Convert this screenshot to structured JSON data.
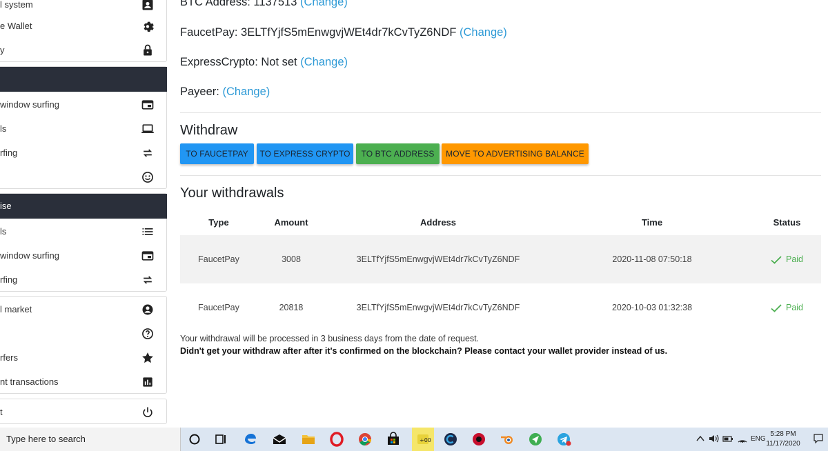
{
  "sidebar": {
    "group1": [
      {
        "label": "l system",
        "icon": "account-box-icon"
      },
      {
        "label": "e Wallet",
        "icon": "gear-icon"
      },
      {
        "label": "y",
        "icon": "lock-icon"
      }
    ],
    "group2": [
      {
        "label": "window surfing",
        "icon": "browser-window-icon"
      },
      {
        "label": "ls",
        "icon": "laptop-icon"
      },
      {
        "label": "rfing",
        "icon": "repeat-arrows-icon"
      },
      {
        "label": "",
        "icon": "smiley-icon"
      }
    ],
    "group3_header": "ise",
    "group3": [
      {
        "label": "ls",
        "icon": "list-icon"
      },
      {
        "label": "window surfing",
        "icon": "browser-window-icon"
      },
      {
        "label": "rfing",
        "icon": "repeat-arrows-icon"
      }
    ],
    "group4": [
      {
        "label": "l market",
        "icon": "account-circle-icon"
      },
      {
        "label": "",
        "icon": "help-circle-icon"
      },
      {
        "label": "rfers",
        "icon": "star-icon"
      },
      {
        "label": "nt transactions",
        "icon": "bar-chart-icon"
      }
    ],
    "group5": [
      {
        "label": "t",
        "icon": "power-icon"
      }
    ]
  },
  "wallets": {
    "btc": {
      "label": "BTC Address: 1137513",
      "change": "(Change)"
    },
    "faucetpay": {
      "label": "FaucetPay: 3ELTfYjfS5mEnwgvjWEt4dr7kCvTyZ6NDF",
      "change": "(Change)"
    },
    "expresscrypto": {
      "label": "ExpressCrypto: Not set",
      "change": "(Change)"
    },
    "payeer": {
      "label": "Payeer:",
      "change": "(Change)"
    }
  },
  "withdraw": {
    "title": "Withdraw",
    "buttons": {
      "faucetpay": "TO FAUCETPAY",
      "express": "TO EXPRESS CRYPTO",
      "btc": "TO BTC ADDRESS",
      "advertising": "MOVE TO ADVERTISING BALANCE"
    },
    "colors": {
      "blue": "#2196f3",
      "green": "#4caf50",
      "orange": "#ff9800"
    }
  },
  "withdrawals": {
    "title": "Your withdrawals",
    "columns": [
      "Type",
      "Amount",
      "Address",
      "Time",
      "Status"
    ],
    "rows": [
      {
        "type": "FaucetPay",
        "amount": "3008",
        "address": "3ELTfYjfS5mEnwgvjWEt4dr7kCvTyZ6NDF",
        "time": "2020-11-08 07:50:18",
        "status": "Paid"
      },
      {
        "type": "FaucetPay",
        "amount": "20818",
        "address": "3ELTfYjfS5mEnwgvjWEt4dr7kCvTyZ6NDF",
        "time": "2020-10-03 01:32:38",
        "status": "Paid"
      }
    ],
    "note": "Your withdrawal will be processed in 3 business days from the date of request.",
    "warning": "Didn't get your withdraw after after it's confirmed on the blockchain? Please contact your wallet provider instead of us."
  },
  "taskbar": {
    "search_placeholder": "Type here to search",
    "icons": [
      "cortana-icon",
      "task-view-icon",
      "edge-icon",
      "mail-icon",
      "file-explorer-icon",
      "opera-icon",
      "chrome-icon",
      "store-icon",
      "app-yellow-icon",
      "ccleaner-icon",
      "brave-icon",
      "blender-icon",
      "maps-icon",
      "telegram-icon"
    ],
    "language": "ENG",
    "time": "5:28 PM",
    "date": "11/17/2020"
  }
}
